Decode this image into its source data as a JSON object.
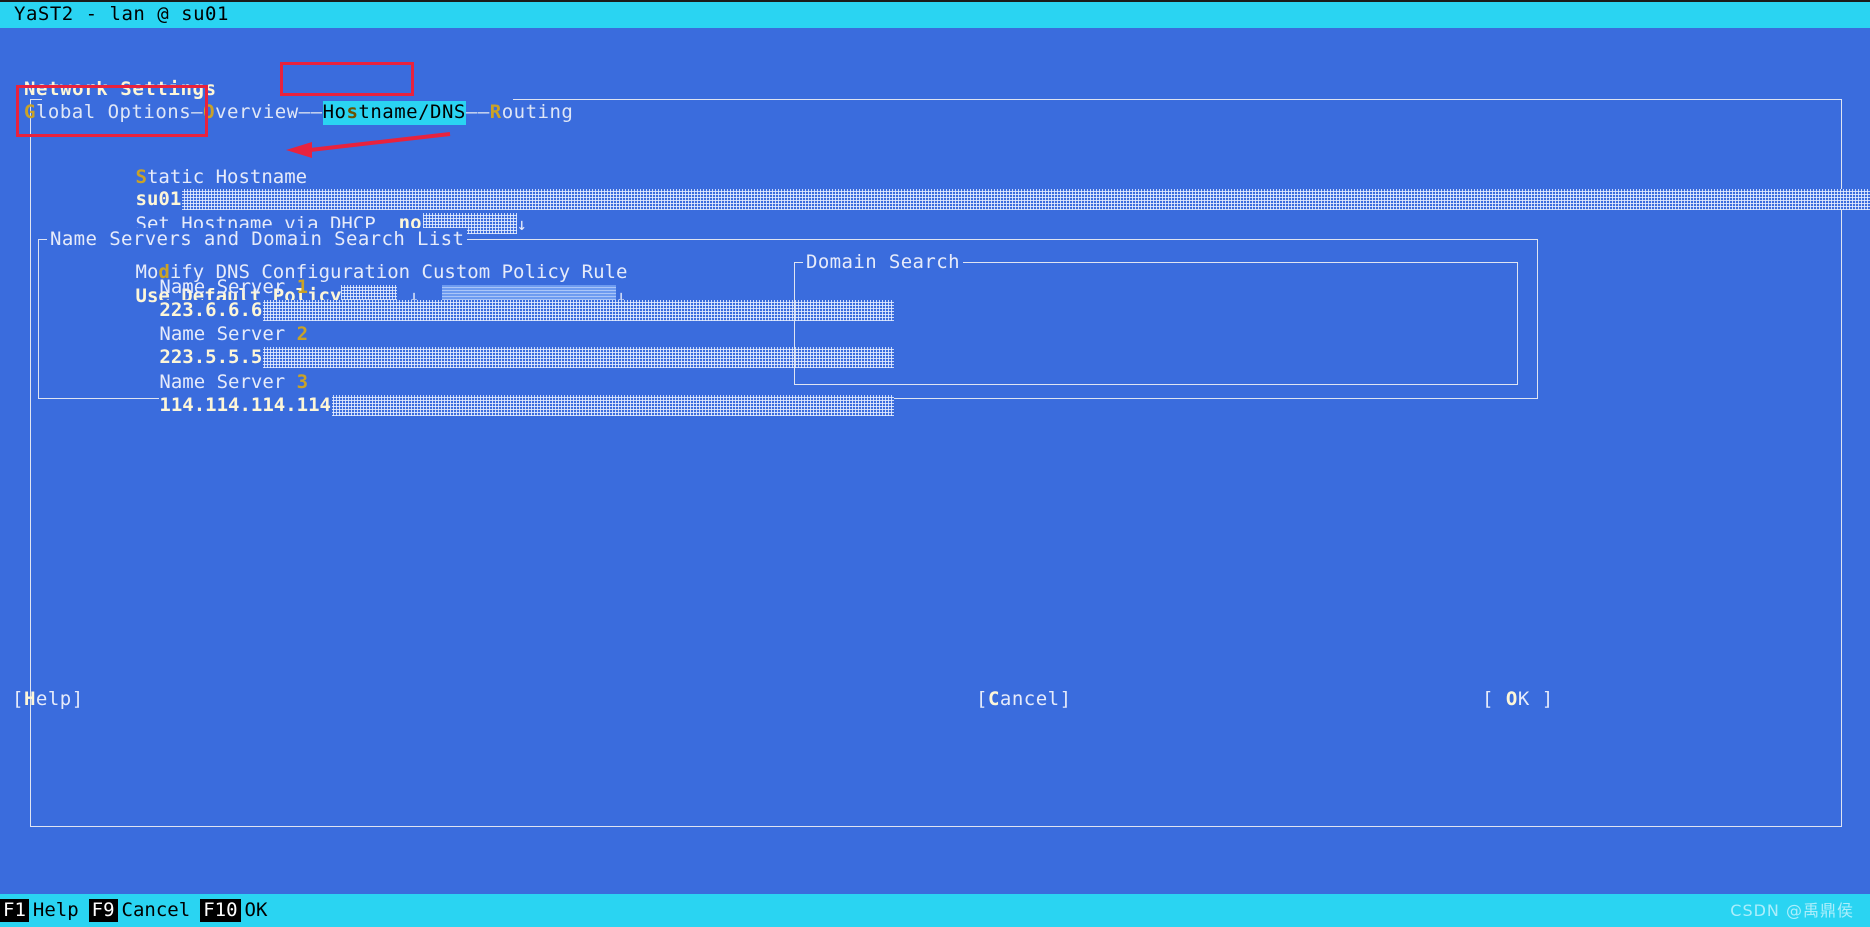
{
  "window": {
    "title": "YaST2 - lan @ su01"
  },
  "page": {
    "title": "Network Settings"
  },
  "tabs": [
    {
      "label": "Global Options",
      "acc": "G",
      "selected": false
    },
    {
      "label": "Overview",
      "acc": "O",
      "selected": false
    },
    {
      "label": "Hostname/DNS",
      "acc": "s",
      "selected": true
    },
    {
      "label": "Routing",
      "acc": "R",
      "selected": false
    }
  ],
  "tab_separator": "—",
  "form": {
    "static_hostname_label": "Static Hostname",
    "static_hostname_acc": "S",
    "static_hostname_value": "su01",
    "set_hostname_dhcp_label": "Set Hostname via DHCP",
    "set_hostname_dhcp_value": "no",
    "modify_dns_label": "Modify DNS Configuration",
    "modify_dns_acc": "d",
    "custom_policy_label": "Custom Policy Rule",
    "use_default_policy_value": "Use Default Policy",
    "dropdown_arrow": "↓"
  },
  "nameservers": {
    "legend": "Name Servers and Domain Search List",
    "entries": [
      {
        "label": "Name Server 1",
        "acc": "1",
        "value": "223.6.6.6"
      },
      {
        "label": "Name Server 2",
        "acc": "2",
        "value": "223.5.5.5"
      },
      {
        "label": "Name Server 3",
        "acc": "3",
        "value": "114.114.114.114"
      }
    ]
  },
  "domain_search": {
    "legend": "Domain Search",
    "value": ""
  },
  "buttons": {
    "help": {
      "pre": "[",
      "acc": "H",
      "post": "elp]"
    },
    "cancel": {
      "pre": "[",
      "acc": "C",
      "post": "ancel]"
    },
    "ok": {
      "pre": "[ ",
      "acc": "O",
      "post": "K ]"
    }
  },
  "function_keys": [
    {
      "key": "F1",
      "label": "Help"
    },
    {
      "key": "F9",
      "label": "Cancel"
    },
    {
      "key": "F10",
      "label": "OK"
    }
  ],
  "watermark": "CSDN @禹鼎侯",
  "colors": {
    "titlebar_bg": "#2ad4f2",
    "body_bg": "#3a6cdd",
    "selected_tab_bg": "#2ad4f2",
    "annotation": "#e8223d",
    "text": "#e6ebfa",
    "bold_text": "#fdf6d8",
    "accelerator": "#c9a227"
  }
}
